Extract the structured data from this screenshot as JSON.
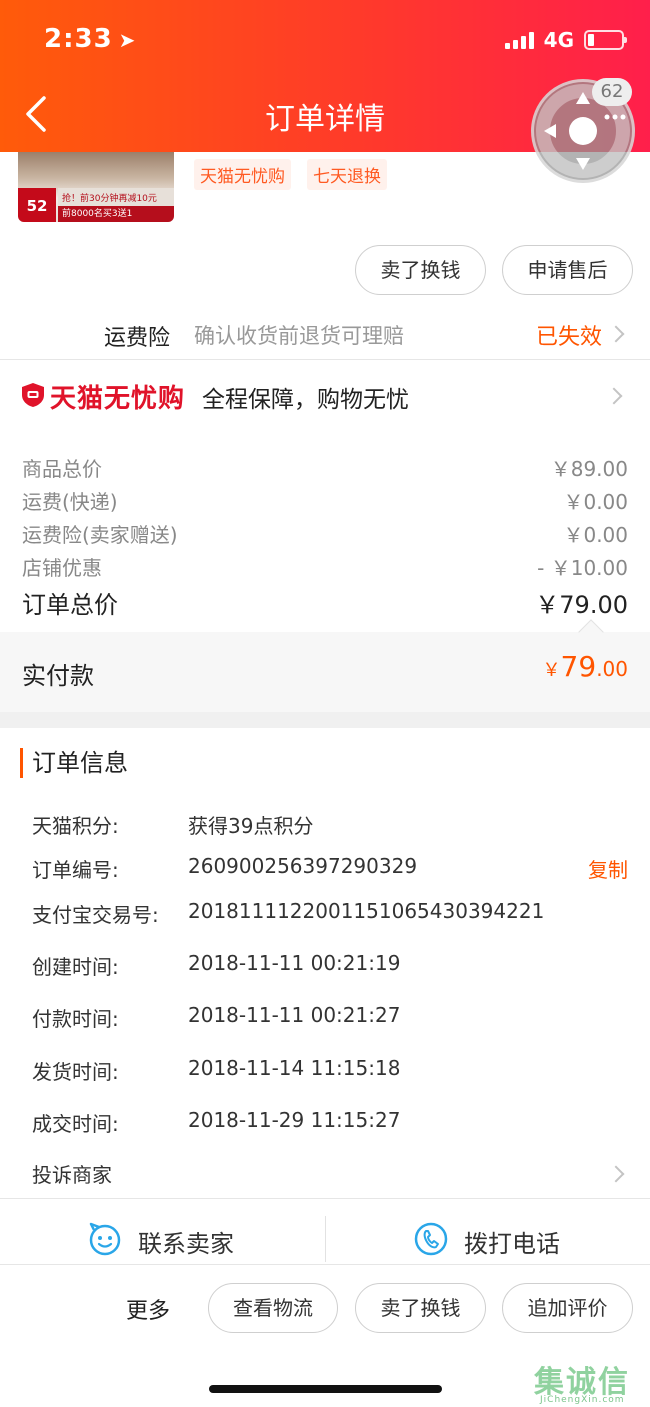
{
  "status_bar": {
    "time": "2:33",
    "network": "4G"
  },
  "header": {
    "title": "订单详情",
    "badge_count": "62"
  },
  "product": {
    "tags": [
      "天猫无忧购",
      "七天退换"
    ],
    "thumb_price": "52",
    "thumb_band": "前8000名买3送1",
    "thumb_band2": "抢！前30分钟再减10元"
  },
  "top_actions": {
    "sell_label": "卖了换钱",
    "aftersale_label": "申请售后"
  },
  "insurance": {
    "label": "运费险",
    "desc": "确认收货前退货可理赔",
    "status": "已失效"
  },
  "tmall_guarantee": {
    "name": "天猫无忧购",
    "slogan": "全程保障，购物无忧"
  },
  "price_lines": [
    {
      "label": "商品总价",
      "value": "￥89.00"
    },
    {
      "label": "运费(快递)",
      "value": "￥0.00"
    },
    {
      "label": "运费险(卖家赠送)",
      "value": "￥0.00"
    },
    {
      "label": "店铺优惠",
      "value": "- ￥10.00"
    }
  ],
  "order_total": {
    "label": "订单总价",
    "value": "￥79.00"
  },
  "paid": {
    "label": "实付款",
    "currency": "￥",
    "integer": "79",
    "decimal": ".00"
  },
  "order_info": {
    "title": "订单信息",
    "rows": [
      {
        "key": "天猫积分:",
        "value": "获得39点积分"
      },
      {
        "key": "订单编号:",
        "value": "260900256397290329"
      },
      {
        "key": "支付宝交易号:",
        "value": "2018111122001151065430394221"
      },
      {
        "key": "创建时间:",
        "value": "2018-11-11 00:21:19"
      },
      {
        "key": "付款时间:",
        "value": "2018-11-11 00:21:27"
      },
      {
        "key": "发货时间:",
        "value": "2018-11-14 11:15:18"
      },
      {
        "key": "成交时间:",
        "value": "2018-11-29 11:15:27"
      }
    ],
    "copy_label": "复制",
    "complain_label": "投诉商家"
  },
  "contact": {
    "seller_label": "联系卖家",
    "call_label": "拨打电话"
  },
  "bottom_bar": {
    "more_label": "更多",
    "buttons": [
      "查看物流",
      "卖了换钱",
      "追加评价"
    ]
  },
  "watermark": {
    "zh": "集诚信",
    "en": "JiChengXin.com"
  },
  "colors": {
    "accent": "#ff5500",
    "tmall_red": "#e0132a",
    "header_start": "#ff5b0a",
    "header_end": "#ff1f4b",
    "contact_blue": "#2aa6e8"
  }
}
